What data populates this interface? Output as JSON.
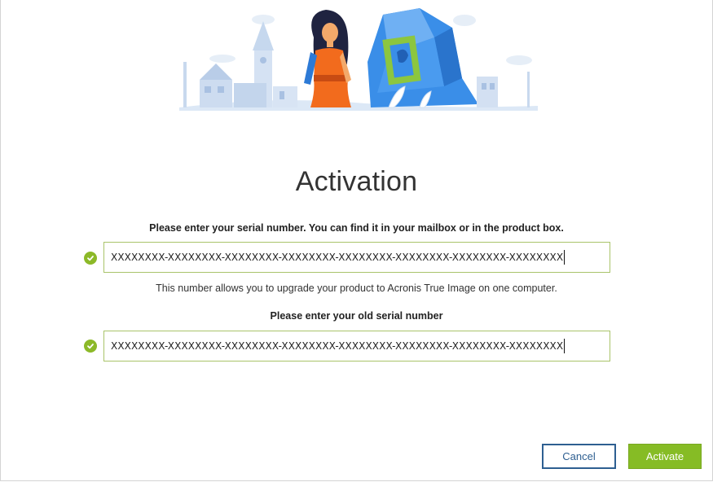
{
  "activation": {
    "title": "Activation",
    "serial_prompt": "Please enter your serial number. You can find it in your mailbox or in the product box.",
    "serial_value": "XXXXXXXX-XXXXXXXX-XXXXXXXX-XXXXXXXX-XXXXXXXX-XXXXXXXX-XXXXXXXX-XXXXXXXX",
    "serial_hint": "This number allows you to upgrade your product to Acronis True Image on one computer.",
    "old_serial_prompt": "Please enter your old serial number",
    "old_serial_value": "XXXXXXXX-XXXXXXXX-XXXXXXXX-XXXXXXXX-XXXXXXXX-XXXXXXXX-XXXXXXXX-XXXXXXXX"
  },
  "buttons": {
    "cancel": "Cancel",
    "activate": "Activate"
  },
  "colors": {
    "accent_green": "#86bc25",
    "cancel_blue": "#2e5f91",
    "field_border": "#a9c46a"
  },
  "icons": [
    "checkmark-icon",
    "checkmark-icon"
  ]
}
